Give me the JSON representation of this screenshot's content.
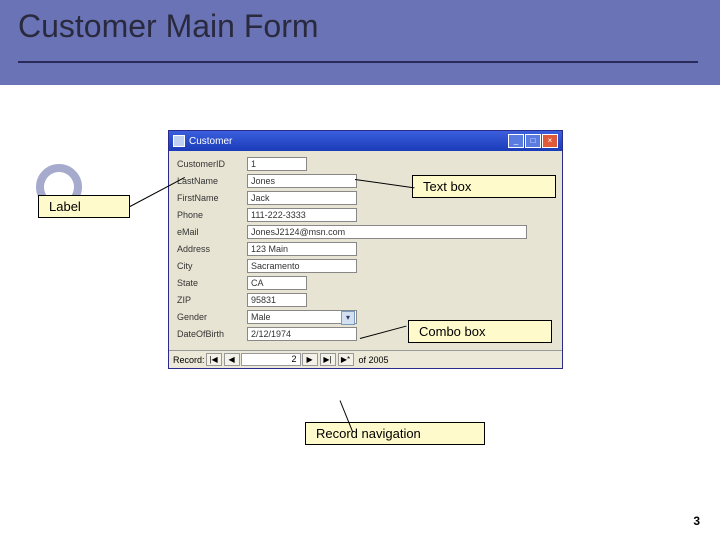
{
  "slide": {
    "title": "Customer Main Form",
    "pageNumber": "3"
  },
  "window": {
    "title": "Customer",
    "buttons": {
      "min": "_",
      "max": "□",
      "close": "×"
    }
  },
  "form": {
    "rows": [
      {
        "label": "CustomerID",
        "value": "1",
        "cls": "w-sm"
      },
      {
        "label": "LastName",
        "value": "Jones",
        "cls": "w-md"
      },
      {
        "label": "FirstName",
        "value": "Jack",
        "cls": "w-md"
      },
      {
        "label": "Phone",
        "value": "111-222-3333",
        "cls": "w-md"
      },
      {
        "label": "eMail",
        "value": "JonesJ2124@msn.com",
        "cls": "w-lg"
      },
      {
        "label": "Address",
        "value": "123 Main",
        "cls": "w-md"
      },
      {
        "label": "City",
        "value": "Sacramento",
        "cls": "w-md"
      },
      {
        "label": "State",
        "value": "CA",
        "cls": "w-sm"
      },
      {
        "label": "ZIP",
        "value": "95831",
        "cls": "w-sm"
      },
      {
        "label": "Gender",
        "value": "Male",
        "cls": "w-md",
        "combo": true
      },
      {
        "label": "DateOfBirth",
        "value": "2/12/1974",
        "cls": "w-md"
      }
    ]
  },
  "recordNav": {
    "label": "Record:",
    "first": "|◀",
    "prev": "◀",
    "current": "2",
    "next": "▶",
    "last": "▶|",
    "new": "▶*",
    "total": "of 2005"
  },
  "callouts": {
    "label": "Label",
    "textbox": "Text box",
    "combo": "Combo box",
    "recnav": "Record navigation"
  }
}
